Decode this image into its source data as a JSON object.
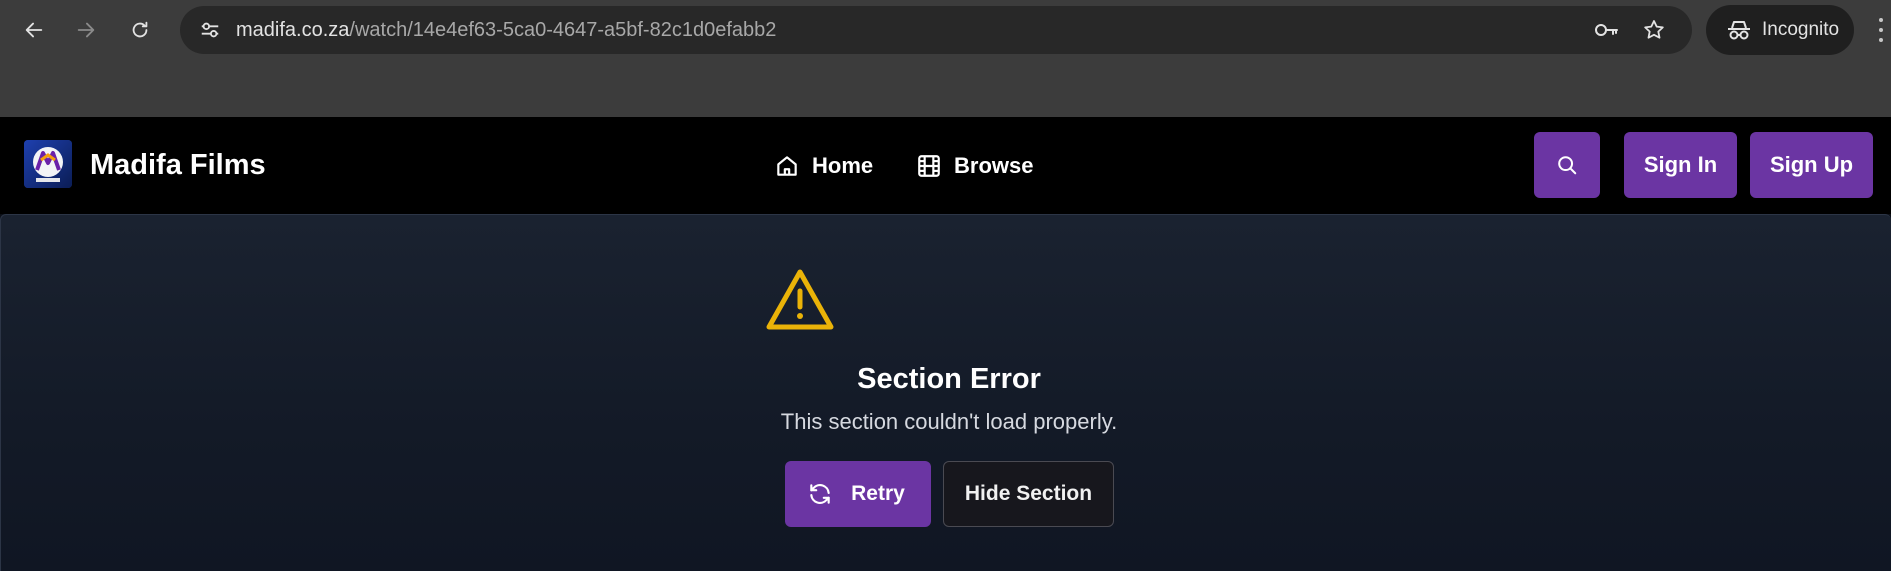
{
  "browser": {
    "url_host": "madifa.co.za",
    "url_path": "/watch/14e4ef63-5ca0-4647-a5bf-82c1d0efabb2",
    "incognito_label": "Incognito",
    "icons": [
      "back-icon",
      "forward-icon",
      "reload-icon",
      "site-settings-icon",
      "password-key-icon",
      "bookmark-star-icon",
      "incognito-icon",
      "more-menu-icon"
    ]
  },
  "header": {
    "brand": "Madifa Films",
    "nav": [
      {
        "label": "Home",
        "icon": "home-icon"
      },
      {
        "label": "Browse",
        "icon": "film-icon"
      }
    ],
    "search_icon": "search-icon",
    "sign_in": "Sign In",
    "sign_up": "Sign Up"
  },
  "error": {
    "icon": "warning-triangle-icon",
    "title": "Section Error",
    "message": "This section couldn't load properly.",
    "retry_label": "Retry",
    "retry_icon": "refresh-icon",
    "hide_label": "Hide Section"
  },
  "colors": {
    "accent": "#6b35a3",
    "warning": "#eab308",
    "chrome_bg": "#3c3c3c",
    "header_bg": "#000000",
    "panel_bg": "#161d2a"
  }
}
